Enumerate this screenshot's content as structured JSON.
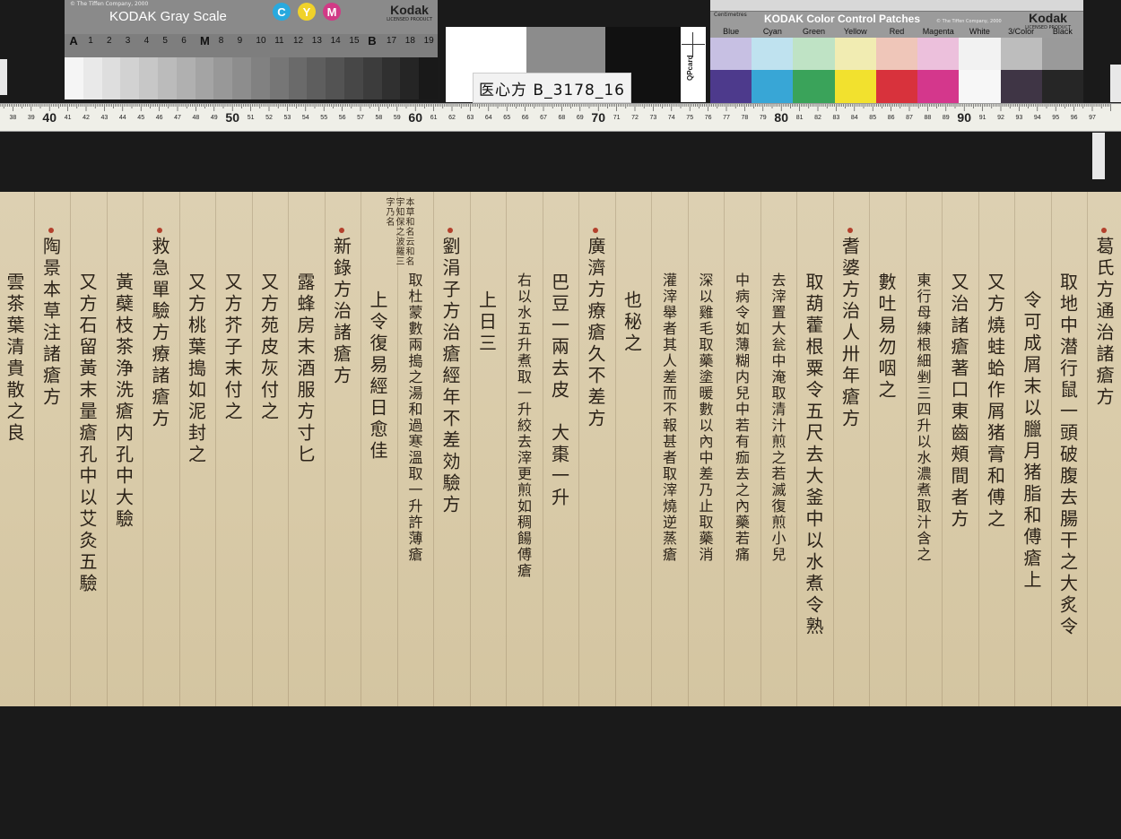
{
  "gray_scale": {
    "copyright": "© The Tiffen Company, 2000",
    "title": "KODAK Gray Scale",
    "cym": [
      "C",
      "Y",
      "M"
    ],
    "brand": "Kodak",
    "brand_sub": "LICENSED PRODUCT",
    "steps": [
      "A",
      "1",
      "2",
      "3",
      "4",
      "5",
      "6",
      "M",
      "8",
      "9",
      "10",
      "11",
      "12",
      "13",
      "14",
      "15",
      "B",
      "17",
      "18",
      "19"
    ]
  },
  "target_label": "医心方 B_3178_16",
  "qp_card": "QPcard",
  "color_patches": {
    "unit": "Centimetres",
    "title": "KODAK Color Control Patches",
    "copyright": "© The Tiffen Company, 2000",
    "brand": "Kodak",
    "brand_sub": "LICENSED PRODUCT",
    "names": [
      "Blue",
      "Cyan",
      "Green",
      "Yellow",
      "Red",
      "Magenta",
      "White",
      "3/Color",
      "Black"
    ],
    "light": [
      "#c7c0e3",
      "#bfe2ef",
      "#bfe3c5",
      "#f1ecb2",
      "#efc6b9",
      "#ecc0dc",
      "#f2f2f2",
      "#bdbdbd",
      "#9a9a9a"
    ],
    "dark": [
      "#4d3a8c",
      "#38a6d6",
      "#3aa35a",
      "#f2e12e",
      "#d8323c",
      "#d4378c",
      "#f7f7f7",
      "#3f3545",
      "#262626"
    ]
  },
  "ruler_labels": [
    {
      "t": "40",
      "big": true
    },
    {
      "t": "50",
      "big": true
    },
    {
      "t": "60",
      "big": true
    },
    {
      "t": "70",
      "big": true
    },
    {
      "t": "80",
      "big": true
    },
    {
      "t": "90",
      "big": true
    }
  ],
  "manuscript": {
    "columns": [
      "葛氏方通治諸瘡方",
      "取地中潜行鼠一頭破腹去腸干之大炙令",
      "令可成屑末以臘月猪脂和傅瘡上",
      "又方燒蛙蛤作屑猪膏和傅之",
      "又治諸瘡著口東齒頰間者方",
      "東行母練根細剉三四升以水濃煮取汁含之",
      "數吐易勿咽之",
      "耆婆方治人卅年瘡方",
      "取葫藿根粟令五尺去大釜中以水煮令熟",
      "去滓置大瓮中淹取清汁煎之若滅復煎小兒",
      "中病令如薄糊内兒中若有痂去之內藥若痛",
      "深以雞毛取藥塗暖數以內中差乃止取藥消",
      "灌滓舉者其人差而不報甚者取滓燒逆蒸瘡",
      "也秘之",
      "廣濟方療瘡久不差方",
      "巴豆一兩去皮　大棗一升",
      "右以水五升煮取一升絞去滓更煎如稠餳傅瘡",
      "上日三",
      "劉涓子方治瘡經年不差効驗方",
      "取杜蒙數兩搗之湯和過寒溫取一升許薄瘡",
      "上令復易經日愈佳",
      "新錄方治諸瘡方",
      "露蜂房末酒服方寸匕",
      "又方苑皮灰付之",
      "又方芥子末付之",
      "又方桃葉搗如泥封之",
      "救急單驗方療諸瘡方",
      "黃蘗枝茶浄洗瘡内孔中大驗",
      "又方石留黃末量瘡孔中以艾灸五驗",
      "陶景本草注諸瘡方",
      "雲茶葉清貴散之良"
    ],
    "side_note": "本草和名云和名宇知保之波羅三字乃名"
  }
}
